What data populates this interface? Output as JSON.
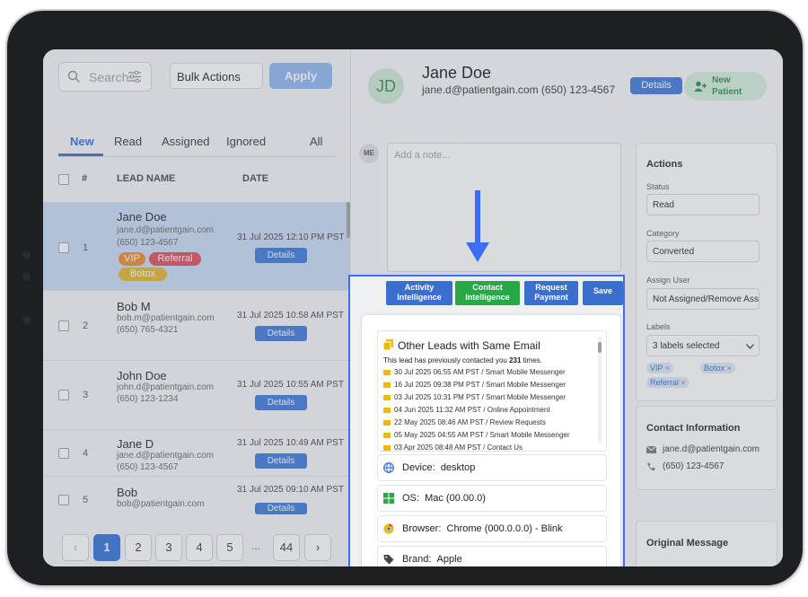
{
  "left_panel": {
    "search_placeholder": "Search",
    "bulk_actions": "Bulk Actions",
    "apply": "Apply",
    "tabs": [
      {
        "label": "New",
        "active": true
      },
      {
        "label": "Read",
        "active": false
      },
      {
        "label": "Assigned",
        "active": false
      },
      {
        "label": "Ignored",
        "active": false
      },
      {
        "label": "All",
        "active": false
      }
    ],
    "columns": {
      "number": "#",
      "lead_name": "LEAD NAME",
      "date": "DATE"
    },
    "rows": [
      {
        "num": "1",
        "name": "Jane Doe",
        "email": "jane.d@patientgain.com",
        "phone": "(650) 123-4567",
        "date": "31 Jul 2025 12:10 PM PST",
        "details": "Details",
        "selected": true,
        "tags": [
          {
            "label": "VIP",
            "color": "#ec8a2b"
          },
          {
            "label": "Referral",
            "color": "#e0485b"
          },
          {
            "label": "Botox",
            "color": "#e3b52b"
          }
        ]
      },
      {
        "num": "2",
        "name": "Bob M",
        "email": "bob.m@patientgain.com",
        "phone": "(650) 765-4321",
        "date": "31 Jul 2025 10:58 AM PST",
        "details": "Details"
      },
      {
        "num": "3",
        "name": "John Doe",
        "email": "john.d@patientgain.com",
        "phone": "(650) 123-1234",
        "date": "31 Jul 2025 10:55 AM PST",
        "details": "Details"
      },
      {
        "num": "4",
        "name": "Jane D",
        "email": "jane.d@patientgain.com",
        "phone": "(650) 123-4567",
        "date": "31 Jul 2025 10:49 AM PST",
        "details": "Details"
      },
      {
        "num": "5",
        "name": "Bob",
        "email": "bob@patientgain.com",
        "phone": "",
        "date": "31 Jul 2025 09:10 AM PST",
        "details": "Details"
      }
    ],
    "pagination": {
      "prev": "‹",
      "next": "›",
      "pages": [
        "1",
        "2",
        "3",
        "4",
        "5",
        "...",
        "44"
      ],
      "current": "1"
    }
  },
  "patient": {
    "initials": "JD",
    "name": "Jane Doe",
    "contact_line": "jane.d@patientgain.com (650) 123-4567",
    "details_button": "Details",
    "new_patient_line1": "New",
    "new_patient_line2": "Patient"
  },
  "note": {
    "avatar": "ME",
    "placeholder": "Add a note..."
  },
  "action_buttons": [
    {
      "line1": "Activity",
      "line2": "Intelligence"
    },
    {
      "line1": "Contact",
      "line2": "Intelligence"
    },
    {
      "line1": "Request",
      "line2": "Payment"
    },
    {
      "line1": "Save",
      "line2": ""
    }
  ],
  "actions_panel": {
    "title": "Actions",
    "status_label": "Status",
    "status_value": "Read",
    "category_label": "Category",
    "category_value": "Converted",
    "assign_label": "Assign User",
    "assign_value": "Not Assigned/Remove Ass",
    "labels_label": "Labels",
    "labels_value": "3 labels selected",
    "labels": [
      "VIP",
      "Botox",
      "Referral"
    ]
  },
  "contact_info": {
    "title": "Contact Information",
    "email": "jane.d@patientgain.com",
    "phone": "(650) 123-4567"
  },
  "original_message": {
    "title": "Original Message"
  },
  "contact_intelligence": {
    "other_leads_title": "Other Leads with Same Email",
    "intro_prefix": "This lead has previously contacted you ",
    "intro_count": "231",
    "intro_suffix": " times.",
    "history": [
      "30 Jul 2025 06:55 AM PST / Smart Mobile Messenger",
      "16 Jul 2025 09:38 PM PST / Smart Mobile Messenger",
      "03 Jul 2025 10:31 PM PST / Smart Mobile Messenger",
      "04 Jun 2025 11:32 AM PST / Online Appointment",
      "22 May 2025 08:46 AM PST / Review Requests",
      "05 May 2025 04:55 AM PST / Smart Mobile Messenger",
      "03 Apr 2025 08:48 AM PST / Contact Us"
    ],
    "device_label": "Device:",
    "device_value": "desktop",
    "os_label": "OS:",
    "os_value": "Mac (00.00.0)",
    "browser_label": "Browser:",
    "browser_value": "Chrome (000.0.0.0) - Blink",
    "brand_label": "Brand:",
    "brand_value": "Apple"
  },
  "colors": {
    "accent": "#2f6fd6",
    "highlight": "#3b6ef5",
    "green": "#27a745"
  }
}
